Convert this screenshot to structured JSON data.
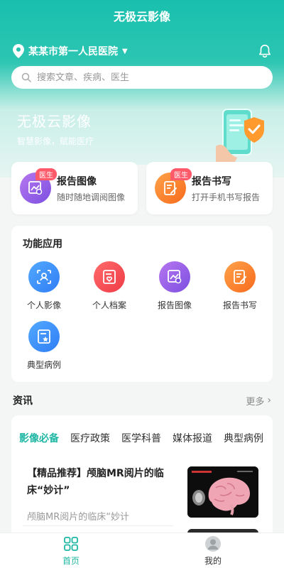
{
  "header": {
    "app_title": "无极云影像",
    "hospital": "某某市第一人民医院",
    "search_placeholder": "搜索文章、疾病、医生"
  },
  "brand": {
    "title": "无极云影像",
    "subtitle": "智慧影像，赋能医疗"
  },
  "report_cards": [
    {
      "title": "报告图像",
      "desc": "随时随地调阅图像",
      "tag": "医生",
      "icon": "image-chart-icon"
    },
    {
      "title": "报告书写",
      "desc": "打开手机书写报告",
      "tag": "医生",
      "icon": "report-edit-icon"
    }
  ],
  "apps": {
    "title": "功能应用",
    "items": [
      {
        "label": "个人影像",
        "icon": "person-scan-icon"
      },
      {
        "label": "个人档案",
        "icon": "file-heart-icon"
      },
      {
        "label": "报告图像",
        "icon": "image-chart-icon"
      },
      {
        "label": "报告书写",
        "icon": "report-edit-icon"
      },
      {
        "label": "典型病例",
        "icon": "case-star-icon"
      }
    ]
  },
  "news": {
    "title": "资讯",
    "more": "更多",
    "tabs": [
      "影像必备",
      "医疗政策",
      "医学科普",
      "媒体报道",
      "典型病例"
    ],
    "active_tab": "影像必备",
    "article": {
      "title": "【精品推荐】颅脑MR阅片的临床“妙计”",
      "summary": "颅脑MR阅片的临床“妙计"
    }
  },
  "bottom_nav": [
    {
      "label": "首页",
      "icon": "home-grid-icon",
      "active": true
    },
    {
      "label": "我的",
      "icon": "user-icon",
      "active": false
    }
  ],
  "colors": {
    "primary": "#1fb7a4",
    "tag_red": "#ff5a6a"
  }
}
